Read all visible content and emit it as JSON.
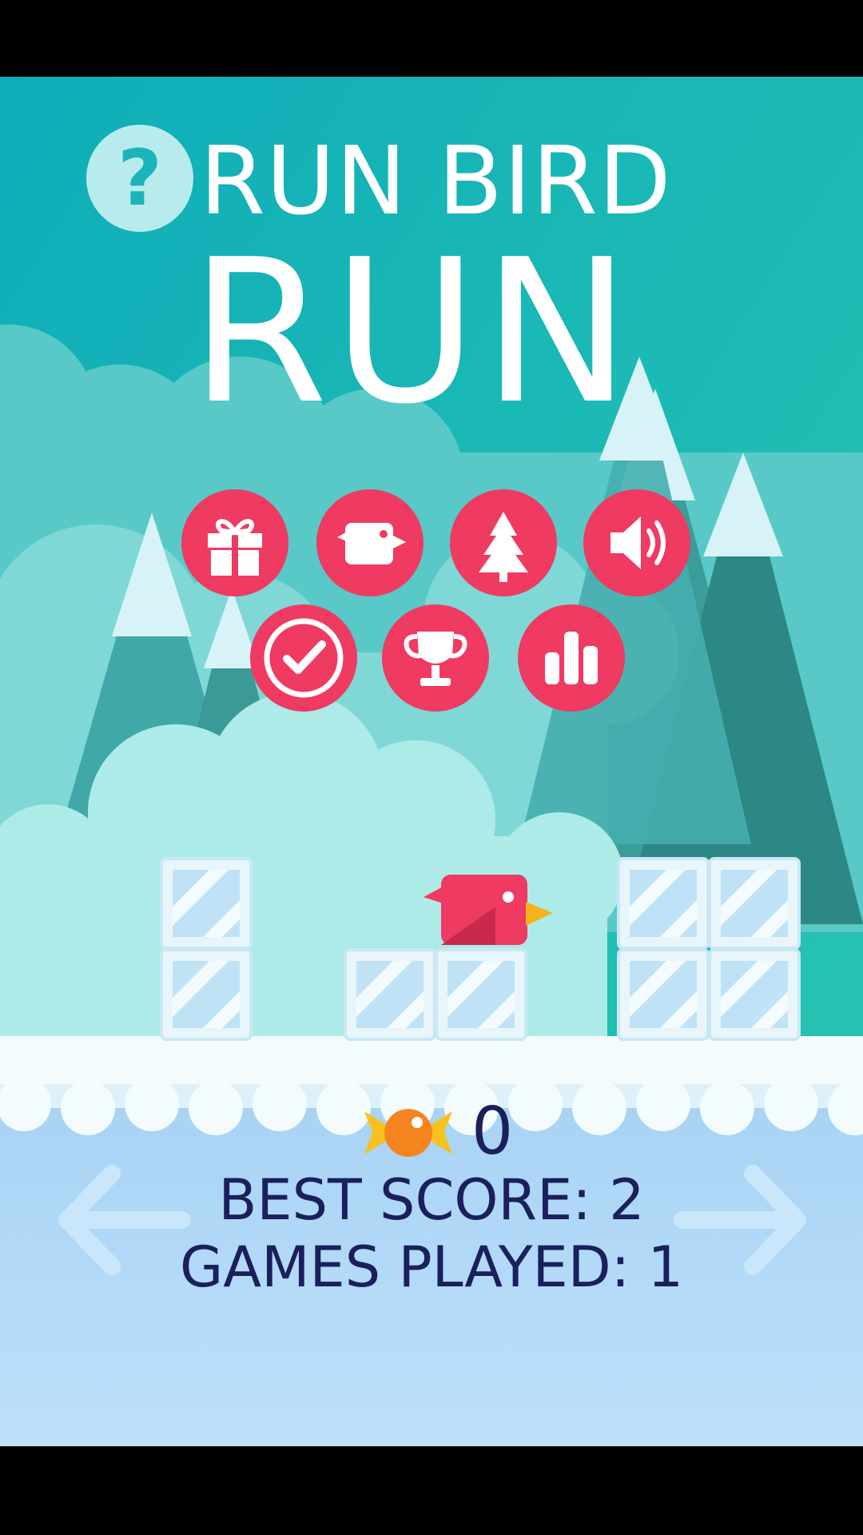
{
  "title": {
    "line1": "RUN BIRD",
    "line2": "RUN"
  },
  "help": {
    "label": "?"
  },
  "menu": {
    "row1": [
      {
        "name": "gift-button",
        "icon": "gift-icon"
      },
      {
        "name": "characters-button",
        "icon": "bird-icon"
      },
      {
        "name": "themes-button",
        "icon": "pine-tree-icon"
      },
      {
        "name": "sound-button",
        "icon": "speaker-icon"
      }
    ],
    "row2": [
      {
        "name": "rate-button",
        "icon": "checkmark-icon"
      },
      {
        "name": "achievements-button",
        "icon": "trophy-icon"
      },
      {
        "name": "leaderboard-button",
        "icon": "bar-chart-icon"
      }
    ]
  },
  "stats": {
    "candy_count": "0",
    "best_score": "BEST SCORE: 2",
    "games_played": "GAMES PLAYED: 1"
  },
  "nav": {
    "left": "left-arrow-icon",
    "right": "right-arrow-icon"
  },
  "colors": {
    "accent": "#ef3a61",
    "sky": "#15b3bb",
    "text": "#1b1f5c",
    "water": "#b4dcfb"
  }
}
